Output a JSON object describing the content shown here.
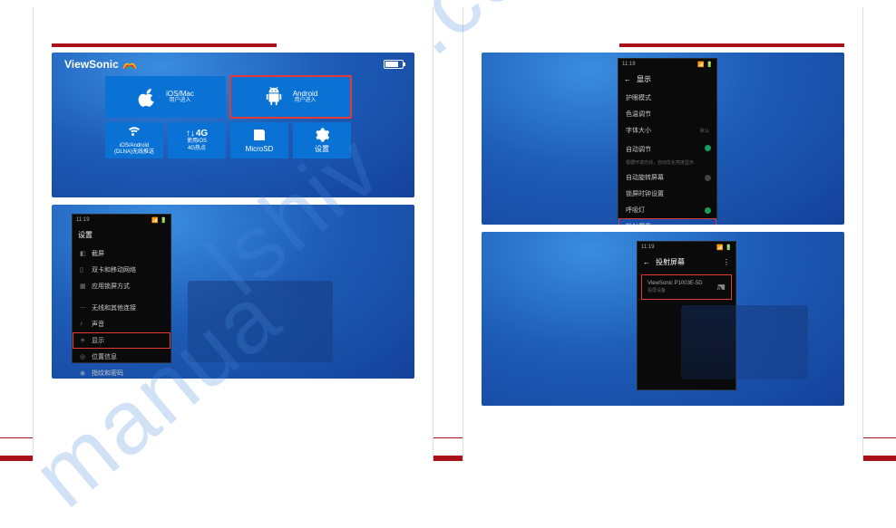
{
  "logo_text": "ViewSonic",
  "tiles": {
    "ios_mac": {
      "title": "iOS/Mac",
      "sub": "用户进入"
    },
    "android": {
      "title": "Android",
      "sub": "用户进入"
    },
    "dlna": {
      "title": "iOS/Android",
      "sub": "(DLNA)无线推送"
    },
    "hotspot": {
      "title": "使用iOS",
      "sub": "4G热点",
      "badge": "4G"
    },
    "microsd": {
      "title": "MicroSD"
    },
    "settings": {
      "title": "设置"
    }
  },
  "phone_settings": {
    "status_time": "11:19",
    "title": "设置",
    "items": [
      {
        "label": "截屏"
      },
      {
        "label": "双卡和移动网络"
      },
      {
        "label": "应用锁屏方式"
      },
      {
        "label": "无线和其他连接"
      },
      {
        "label": "声音"
      },
      {
        "label": "显示",
        "selected": true
      },
      {
        "label": "位置信息"
      },
      {
        "label": "指纹和密码"
      }
    ]
  },
  "phone_display": {
    "status_time": "11:19",
    "title": "显示",
    "items": [
      {
        "label": "护眼模式"
      },
      {
        "label": "色温调节"
      },
      {
        "label": "字体大小",
        "value": "默认"
      },
      {
        "label": "自动调节",
        "sub": "根据环境光线，自动优化亮度显示",
        "toggle": "on"
      },
      {
        "label": "自动旋转屏幕",
        "toggle": "off"
      },
      {
        "label": "锁屏时钟设置"
      },
      {
        "label": "呼吸灯",
        "toggle": "on"
      },
      {
        "label": "投射屏幕",
        "selected": true
      }
    ]
  },
  "phone_cast": {
    "status_time": "11:19",
    "title": "投射屏幕",
    "device_name": "ViewSonic P1003E-5D",
    "device_status": "投屏设备"
  }
}
